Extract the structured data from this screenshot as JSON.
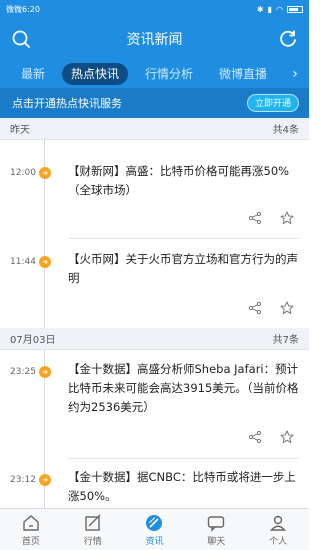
{
  "status": {
    "carrier": "微微6:20",
    "battery": "battery"
  },
  "header": {
    "title": "资讯新闻",
    "search_icon": "search-icon",
    "refresh_icon": "refresh-icon"
  },
  "tabs": [
    {
      "label": "最新"
    },
    {
      "label": "热点快讯",
      "active": true
    },
    {
      "label": "行情分析"
    },
    {
      "label": "微博直播"
    }
  ],
  "promo": {
    "text": "点击开通热点快讯服务",
    "button": "立即开通"
  },
  "sections": [
    {
      "date": "昨天",
      "count": "共4条"
    },
    {
      "date": "07月03日",
      "count": "共7条"
    }
  ],
  "news": [
    {
      "time": "12:00",
      "text": "【财新网】高盛：比特币价格可能再涨50%（全球市场）"
    },
    {
      "time": "11:44",
      "text": "【火币网】关于火币官方立场和官方行为的声明"
    },
    {
      "time": "23:25",
      "text": "【金十数据】高盛分析师Sheba Jafari：预计比特币未来可能会高达3915美元。（当前价格约为2536美元）"
    },
    {
      "time": "23:12",
      "text": "【金十数据】据CNBC：比特币或将进一步上涨50%。"
    }
  ],
  "bottom_nav": [
    {
      "label": "首页",
      "icon": "home-icon"
    },
    {
      "label": "行情",
      "icon": "chart-icon"
    },
    {
      "label": "资讯",
      "icon": "news-icon",
      "active": true
    },
    {
      "label": "聊天",
      "icon": "chat-icon"
    },
    {
      "label": "个人",
      "icon": "user-icon"
    }
  ],
  "colors": {
    "primary": "#1f8ee0",
    "accent": "#f4a623"
  }
}
